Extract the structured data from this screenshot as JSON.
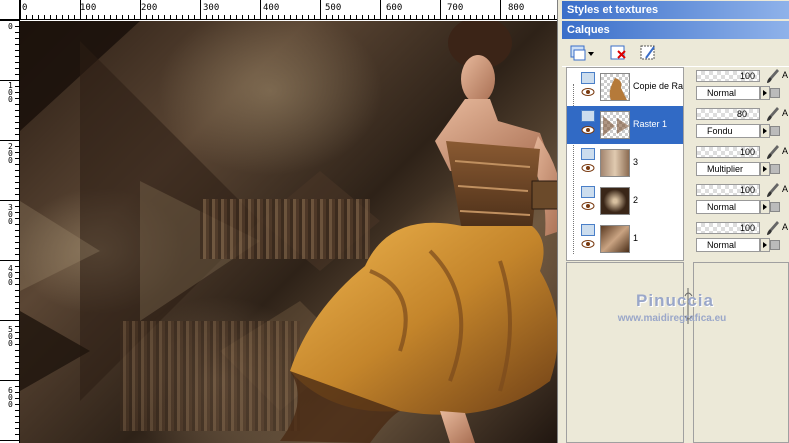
{
  "rulers": {
    "top_labels": [
      "0",
      "100",
      "200",
      "300",
      "400",
      "500",
      "600",
      "700",
      "800"
    ],
    "left_labels": [
      "0",
      "100",
      "200",
      "300",
      "400",
      "500",
      "600",
      "700"
    ]
  },
  "panels": {
    "styles_title": "Styles et textures",
    "layers_title": "Calques"
  },
  "layers": [
    {
      "name": "Copie de Ra",
      "opacity": "100",
      "blend": "Normal",
      "selected": false
    },
    {
      "name": "Raster 1",
      "opacity": "80",
      "blend": "Fondu",
      "selected": true
    },
    {
      "name": "3",
      "opacity": "100",
      "blend": "Multiplier",
      "selected": false
    },
    {
      "name": "2",
      "opacity": "100",
      "blend": "Normal",
      "selected": false
    },
    {
      "name": "1",
      "opacity": "100",
      "blend": "Normal",
      "selected": false
    }
  ],
  "edge_letter": "A",
  "watermark": {
    "name": "Pinuccia",
    "url": "www.maidiregrafica.eu"
  },
  "colors": {
    "title_bar_start": "#3a6ec9",
    "title_bar_end": "#8fb2ea",
    "selected_row": "#316ac5",
    "panel_bg": "#ece9d8"
  }
}
